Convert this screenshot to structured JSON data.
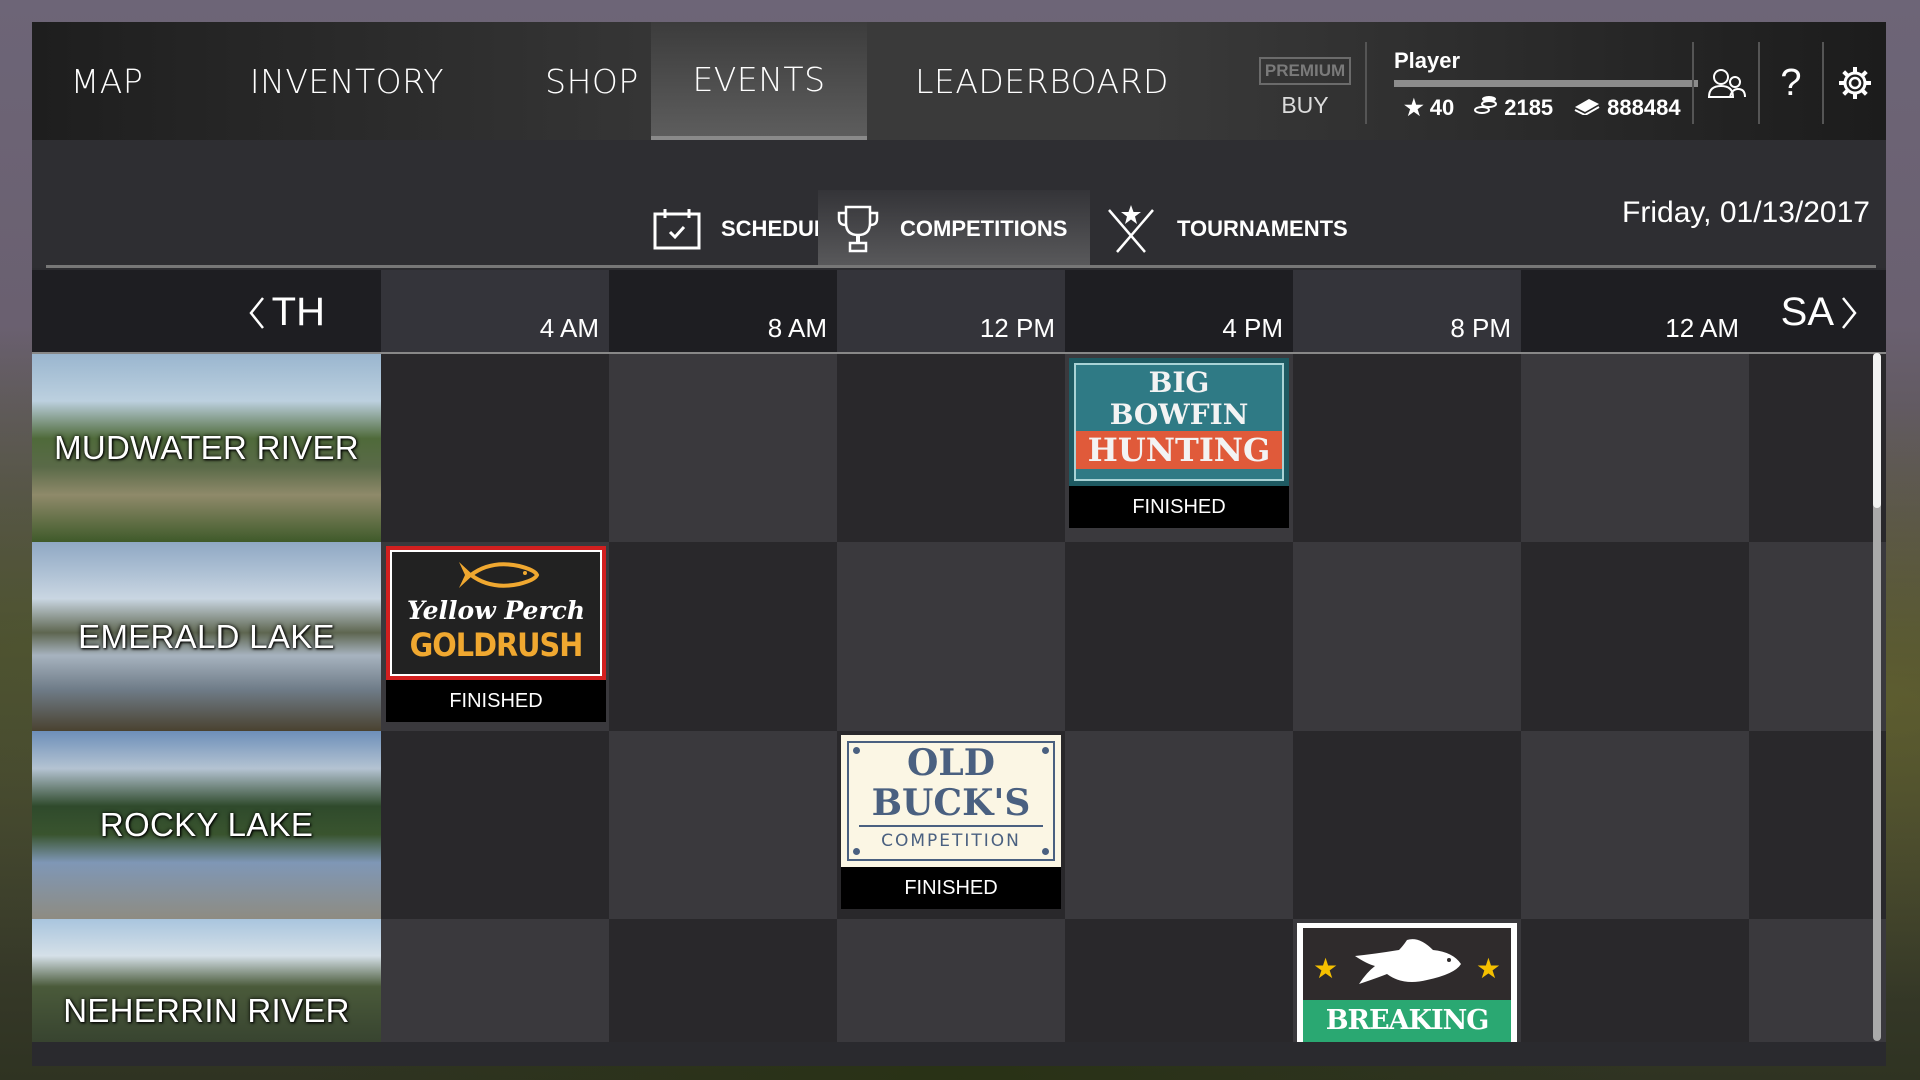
{
  "nav": {
    "items": [
      {
        "label": "MAP"
      },
      {
        "label": "INVENTORY"
      },
      {
        "label": "SHOP"
      },
      {
        "label": "EVENTS",
        "active": true
      },
      {
        "label": "LEADERBOARD"
      }
    ]
  },
  "premium": {
    "badge": "PREMIUM",
    "buy_label": "BUY"
  },
  "player": {
    "name": "Player",
    "stars": "40",
    "coins": "2185",
    "cash": "888484"
  },
  "icons": {
    "friends": "friends-icon",
    "help": "?",
    "settings": "gear-icon"
  },
  "subtabs": [
    {
      "label": "SCHEDULE",
      "icon": "calendar-check-icon"
    },
    {
      "label": "COMPETITIONS",
      "icon": "trophy-icon",
      "active": true
    },
    {
      "label": "TOURNAMENTS",
      "icon": "crossed-rods-star-icon"
    }
  ],
  "date": "Friday, 01/13/2017",
  "schedule": {
    "prev_day": "TH",
    "next_day": "SA",
    "times": [
      "4 AM",
      "8 AM",
      "12 PM",
      "4 PM",
      "8 PM",
      "12 AM"
    ],
    "locations": [
      {
        "name": "MUDWATER RIVER"
      },
      {
        "name": "EMERALD LAKE"
      },
      {
        "name": "ROCKY LAKE"
      },
      {
        "name": "NEHERRIN RIVER"
      }
    ],
    "events": [
      {
        "title_lines": [
          "BIG",
          "BOWFIN",
          "HUNTING"
        ],
        "status": "FINISHED",
        "location": "MUDWATER RIVER",
        "time_slot": "4 PM",
        "colors": {
          "bg": "#2f7a85",
          "band": "#e05a3a"
        }
      },
      {
        "title_lines": [
          "Yellow Perch",
          "GOLDRUSH"
        ],
        "status": "FINISHED",
        "location": "EMERALD LAKE",
        "time_slot": "4 AM",
        "colors": {
          "bg": "#222222",
          "accent": "#f0a830",
          "border": "#d21f1f"
        }
      },
      {
        "title_lines": [
          "OLD",
          "BUCK'S",
          "COMPETITION"
        ],
        "status": "FINISHED",
        "location": "ROCKY LAKE",
        "time_slot": "12 PM",
        "colors": {
          "bg": "#fbf6e4",
          "text": "#4a6080"
        }
      },
      {
        "title_lines": [
          "BREAKING SHAD"
        ],
        "status": "",
        "location": "NEHERRIN RIVER",
        "time_slot": "8 PM",
        "colors": {
          "bg": "#2f2b2c",
          "band": "#2aa872",
          "star": "#f5c000"
        }
      }
    ]
  }
}
